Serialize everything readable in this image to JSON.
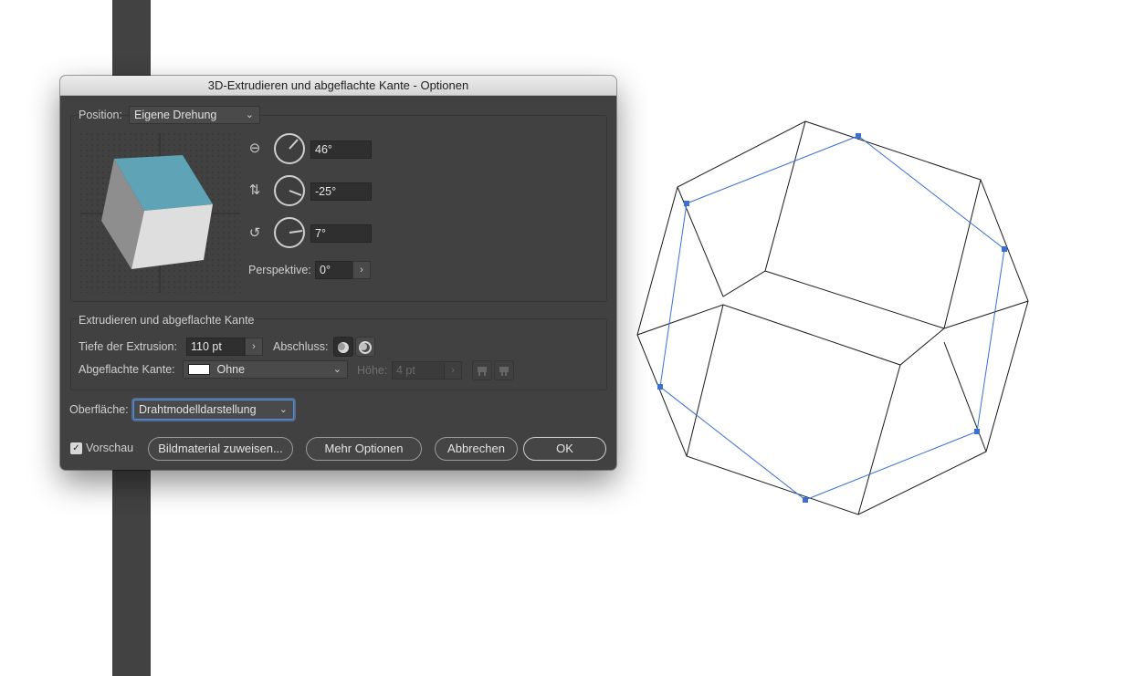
{
  "window_title": "3D-Extrudieren und abgeflachte Kante - Optionen",
  "position": {
    "label": "Position:",
    "selected": "Eigene Drehung",
    "x_rotation": "46°",
    "y_rotation": "-25°",
    "z_rotation": "7°",
    "perspective_label": "Perspektive:",
    "perspective_value": "0°"
  },
  "extrude": {
    "group_title": "Extrudieren und abgeflachte Kante",
    "depth_label": "Tiefe der Extrusion:",
    "depth_value": "110 pt",
    "cap_label": "Abschluss:",
    "bevel_label": "Abgeflachte Kante:",
    "bevel_value": "Ohne",
    "height_label": "Höhe:",
    "height_value": "4 pt"
  },
  "surface": {
    "label": "Oberfläche:",
    "selected": "Drahtmodelldarstellung"
  },
  "footer": {
    "preview_label": "Vorschau",
    "preview_checked": true,
    "map_art_button": "Bildmaterial zuweisen...",
    "more_options_button": "Mehr Optionen",
    "cancel_button": "Abbrechen",
    "ok_button": "OK"
  },
  "colors": {
    "cube_top": "#5fa3b6",
    "wireframe_selection": "#3a6fd8",
    "dialog_bg": "#414141"
  }
}
